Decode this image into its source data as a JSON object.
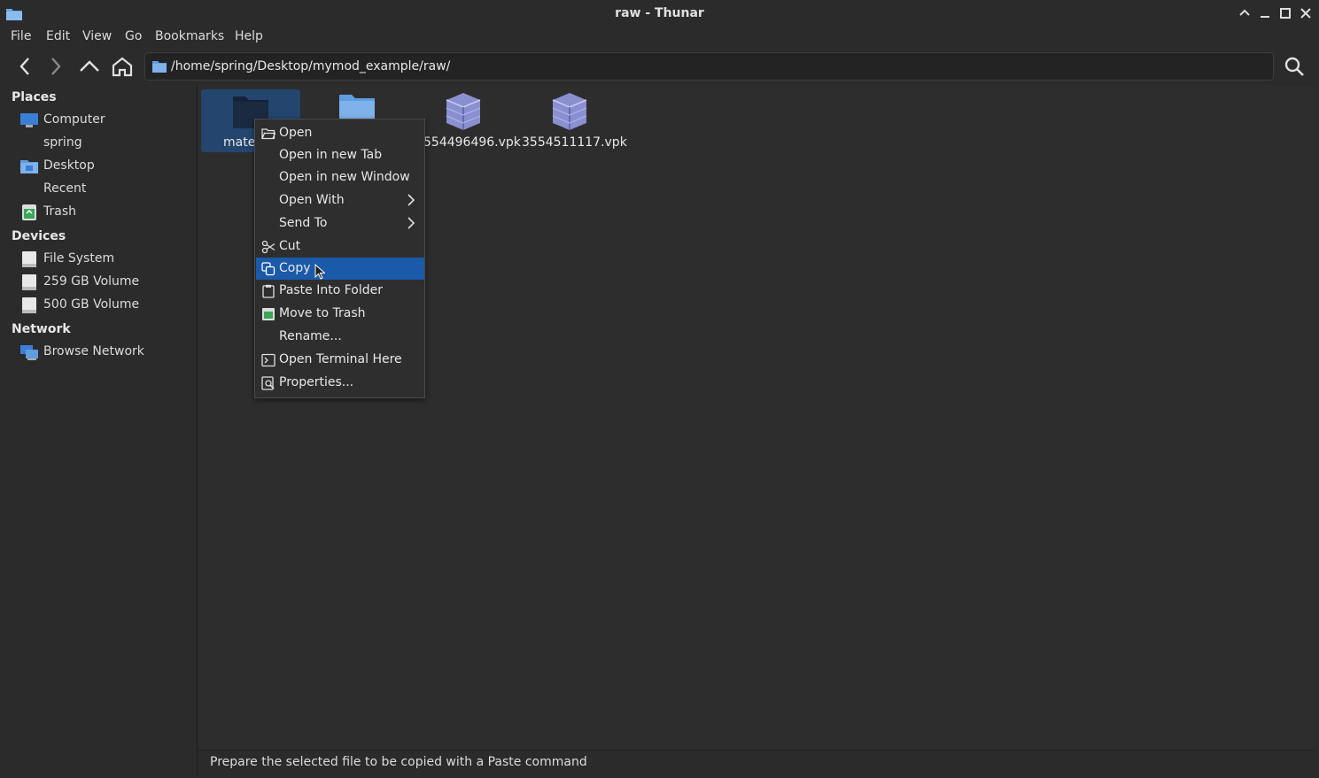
{
  "window": {
    "title": "raw - Thunar"
  },
  "menubar": [
    "File",
    "Edit",
    "View",
    "Go",
    "Bookmarks",
    "Help"
  ],
  "location": {
    "path": "/home/spring/Desktop/mymod_example/raw/"
  },
  "sidebar": {
    "places_header": "Places",
    "places": [
      {
        "label": "Computer",
        "icon": "computer-icon"
      },
      {
        "label": "spring",
        "icon": "home-icon"
      },
      {
        "label": "Desktop",
        "icon": "desktop-folder-icon"
      },
      {
        "label": "Recent",
        "icon": "recent-icon"
      },
      {
        "label": "Trash",
        "icon": "trash-icon"
      }
    ],
    "devices_header": "Devices",
    "devices": [
      {
        "label": "File System",
        "icon": "drive-icon"
      },
      {
        "label": "259 GB Volume",
        "icon": "drive-icon"
      },
      {
        "label": "500 GB Volume",
        "icon": "drive-icon"
      }
    ],
    "network_header": "Network",
    "network": [
      {
        "label": "Browse Network",
        "icon": "network-icon"
      }
    ]
  },
  "files": [
    {
      "name": "mate",
      "type": "folder",
      "selected": true
    },
    {
      "name": "",
      "type": "folder",
      "selected": false
    },
    {
      "name": "554496496.vpk",
      "type": "vpk",
      "selected": false
    },
    {
      "name": "3554511117.vpk",
      "type": "vpk",
      "selected": false
    }
  ],
  "context_menu": {
    "items": [
      {
        "label": "Open",
        "icon": "folder-open-icon"
      },
      {
        "label": "Open in new Tab",
        "icon": ""
      },
      {
        "label": "Open in new Window",
        "icon": ""
      },
      {
        "label": "Open With",
        "icon": "",
        "submenu": true
      },
      {
        "label": "Send To",
        "icon": "",
        "submenu": true
      },
      {
        "label": "Cut",
        "icon": "scissors-icon"
      },
      {
        "label": "Copy",
        "icon": "copy-icon",
        "active": true
      },
      {
        "label": "Paste Into Folder",
        "icon": "clipboard-icon"
      },
      {
        "label": "Move to Trash",
        "icon": "trash-icon"
      },
      {
        "label": "Rename...",
        "icon": ""
      },
      {
        "label": "Open Terminal Here",
        "icon": "terminal-icon"
      },
      {
        "label": "Properties...",
        "icon": "properties-icon"
      }
    ]
  },
  "statusbar": {
    "text": "Prepare the selected file to be copied with a Paste command"
  },
  "colors": {
    "accent": "#1b5aa8",
    "selection": "#23456e",
    "background": "#2b2b2b"
  }
}
